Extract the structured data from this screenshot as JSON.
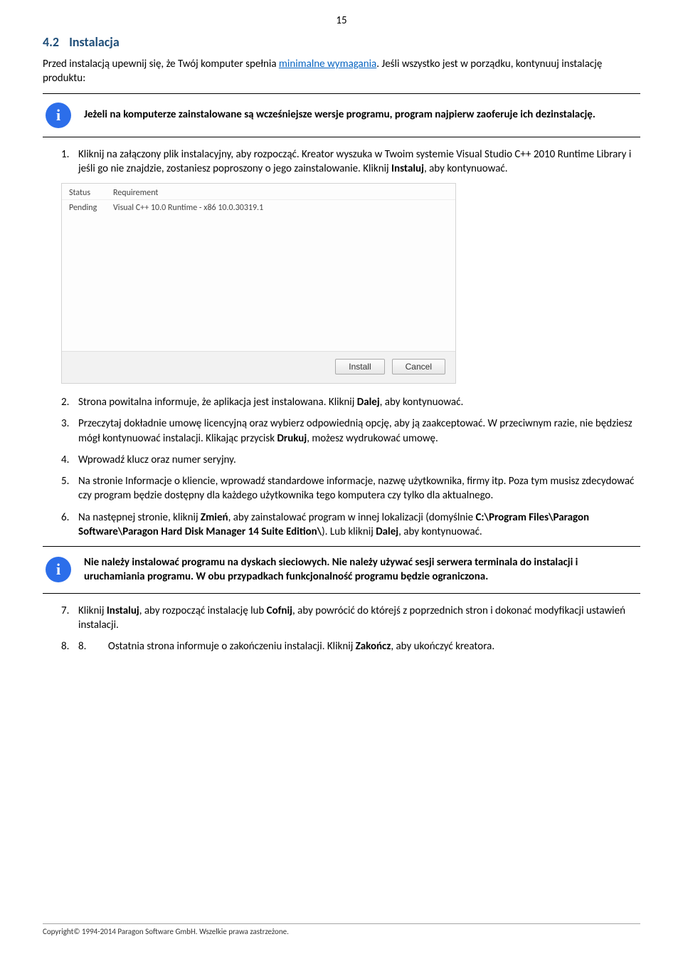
{
  "page_number": "15",
  "heading": {
    "num": "4.2",
    "title": "Instalacja"
  },
  "intro": {
    "pre": "Przed instalacją upewnij się, że Twój komputer spełnia ",
    "link": "minimalne wymagania",
    "post": ". Jeśli wszystko jest w porządku, kontynuuj instalację produktu:"
  },
  "info1": "Jeżeli na komputerze zainstalowane są wcześniejsze wersje programu, program najpierw zaoferuje ich dezinstalację.",
  "step1": {
    "num": "1.",
    "t1": "Kliknij na załączony plik instalacyjny, aby rozpocząć. Kreator wyszuka w Twoim systemie Visual Studio C++ 2010 Runtime Library i jeśli go nie znajdzie, zostaniesz poproszony o jego zainstalowanie. Kliknij ",
    "b1": "Instaluj",
    "t2": ", aby kontynuować."
  },
  "screenshot": {
    "h_status": "Status",
    "h_req": "Requirement",
    "r_status": "Pending",
    "r_req": "Visual C++ 10.0 Runtime - x86 10.0.30319.1",
    "btn_install": "Install",
    "btn_cancel": "Cancel"
  },
  "step2": {
    "num": "2.",
    "t1": "Strona powitalna informuje, że aplikacja jest instalowana. Kliknij ",
    "b1": "Dalej",
    "t2": ", aby kontynuować."
  },
  "step3": {
    "num": "3.",
    "t1": "Przeczytaj dokładnie umowę licencyjną oraz wybierz odpowiednią opcję, aby ją zaakceptować. W przeciwnym razie, nie będziesz mógł kontynuować instalacji. Klikając przycisk ",
    "b1": "Drukuj",
    "t2": ", możesz wydrukować umowę."
  },
  "step4": {
    "num": "4.",
    "t1": "Wprowadź klucz oraz numer seryjny."
  },
  "step5": {
    "num": "5.",
    "t1": "Na stronie Informacje o kliencie, wprowadź standardowe informacje, nazwę użytkownika, firmy itp. Poza tym musisz zdecydować czy program będzie dostępny dla każdego użytkownika tego komputera czy tylko dla aktualnego."
  },
  "step6": {
    "num": "6.",
    "t1": "Na następnej stronie, kliknij ",
    "b1": "Zmień",
    "t2": ", aby zainstalować program w innej lokalizacji (domyślnie ",
    "b2": "C:\\Program Files\\Paragon Software\\Paragon Hard Disk Manager 14 Suite Edition\\",
    "t3": "). Lub kliknij ",
    "b3": "Dalej",
    "t4": ", aby kontynuować."
  },
  "info2": "Nie należy instalować programu na dyskach sieciowych. Nie należy używać sesji serwera terminala do instalacji i uruchamiania programu. W obu przypadkach funkcjonalność programu będzie ograniczona.",
  "step7": {
    "num": "7.",
    "t1": "Kliknij ",
    "b1": "Instaluj",
    "t2": ", aby rozpocząć instalację lub ",
    "b2": "Cofnij",
    "t3": ", aby powrócić do którejś z poprzednich stron i dokonać modyfikacji ustawień instalacji."
  },
  "step8": {
    "num": "8.",
    "t0": "8.",
    "t1": "Ostatnia strona informuje o zakończeniu instalacji. Kliknij ",
    "b1": "Zakończ",
    "t2": ", aby ukończyć kreatora."
  },
  "footer": "Copyright© 1994-2014 Paragon Software GmbH. Wszelkie prawa zastrzeżone."
}
